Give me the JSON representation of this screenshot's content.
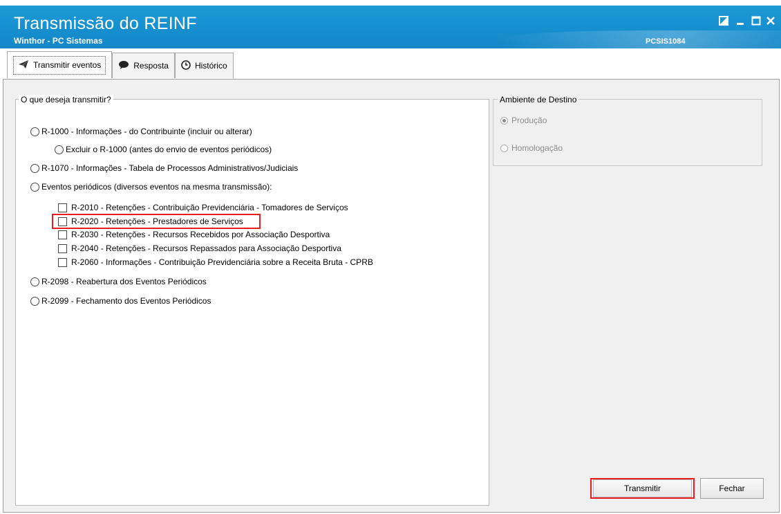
{
  "window": {
    "title": "Transmissão do REINF",
    "subtitle": "Winthor - PC Sistemas",
    "code": "PCSIS1084"
  },
  "tabs": [
    {
      "label": "Transmitir eventos",
      "icon": "paper-plane-icon",
      "active": true
    },
    {
      "label": "Resposta",
      "icon": "speech-bubble-icon",
      "active": false
    },
    {
      "label": "Histórico",
      "icon": "clock-icon",
      "active": false
    }
  ],
  "transmit_group": {
    "legend": "O que deseja transmitir?",
    "options": {
      "r1000": "R-1000 - Informações - do Contribuinte (incluir ou alterar)",
      "r1000_excluir": "Excluir o R-1000 (antes do envio de eventos periódicos)",
      "r1070": "R-1070 - Informações - Tabela de Processos Administrativos/Judiciais",
      "periodicos": "Eventos periódicos (diversos eventos na mesma transmissão):",
      "r2098": "R-2098 - Reabertura dos Eventos Periódicos",
      "r2099": "R-2099 - Fechamento dos Eventos Periódicos"
    },
    "checkboxes": [
      "R-2010 - Retenções - Contribuição Previdenciária - Tomadores de Serviços",
      "R-2020 - Retenções - Prestadores de Serviços",
      "R-2030 - Retenções - Recursos Recebidos por Associação Desportiva",
      "R-2040 - Retenções - Recursos Repassados para Associação Desportiva",
      "R-2060 - Informações - Contribuição Previdenciária sobre a Receita Bruta - CPRB"
    ]
  },
  "ambiente_group": {
    "legend": "Ambiente de Destino",
    "options": [
      "Produção",
      "Homologação"
    ],
    "selected": "Produção"
  },
  "buttons": {
    "transmitir": "Transmitir",
    "fechar": "Fechar"
  },
  "colors": {
    "titlebar": "#168fcf",
    "highlight": "#e81d1d"
  }
}
